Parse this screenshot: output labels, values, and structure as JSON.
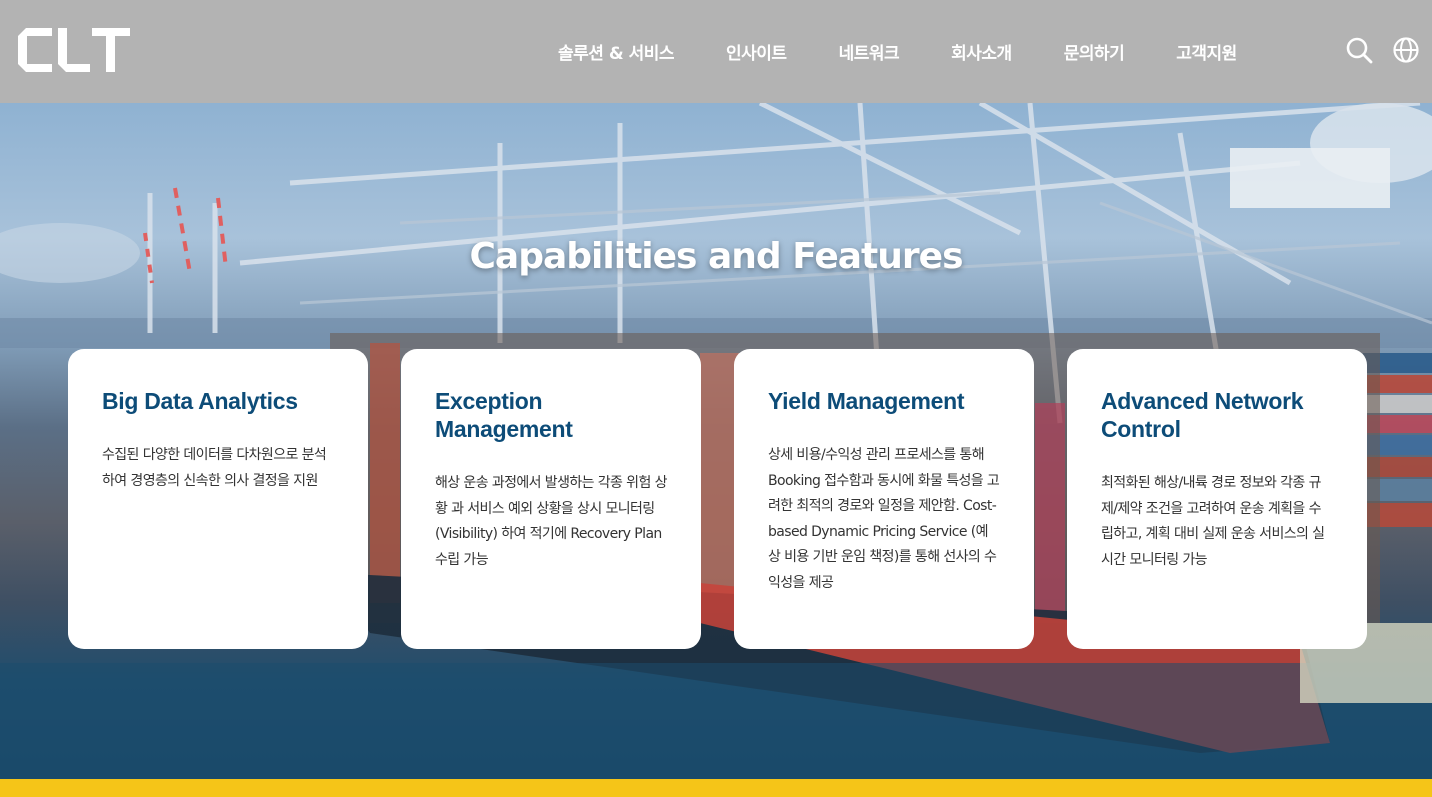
{
  "brand": {
    "logo_text": "CLT"
  },
  "nav": {
    "items": [
      "솔루션 & 서비스",
      "인사이트",
      "네트워크",
      "회사소개",
      "문의하기",
      "고객지원"
    ]
  },
  "header_icons": {
    "search": "search-icon",
    "language": "globe-icon"
  },
  "hero": {
    "title": "Capabilities and Features",
    "cards": [
      {
        "title": "Big Data Analytics",
        "description": "수집된 다양한 데이터를 다차원으로 분석하여 경영층의 신속한 의사 결정을 지원"
      },
      {
        "title": "Exception Management",
        "description": "해상 운송 과정에서 발생하는 각종 위험 상황 과 서비스 예외 상황을 상시 모니터링(Visibility) 하여 적기에 Recovery Plan 수립 가능"
      },
      {
        "title": "Yield Management",
        "description": "상세 비용/수익성 관리 프로세스를 통해 Booking 접수함과 동시에 화물 특성을 고려한 최적의 경로와 일정을 제안함. Cost-based Dynamic Pricing Service (예상 비용 기반 운임 책정)를 통해 선사의 수익성을 제공"
      },
      {
        "title": "Advanced Network Control",
        "description": "최적화된 해상/내륙 경로 정보와 각종 규제/제약 조건을 고려하여 운송 계획을 수립하고, 계획 대비 실제 운송 서비스의 실시간 모니터링 가능"
      }
    ]
  },
  "colors": {
    "header_bg": "#b3b3b3",
    "card_title": "#0d4c78",
    "accent_bar": "#f5c518"
  }
}
